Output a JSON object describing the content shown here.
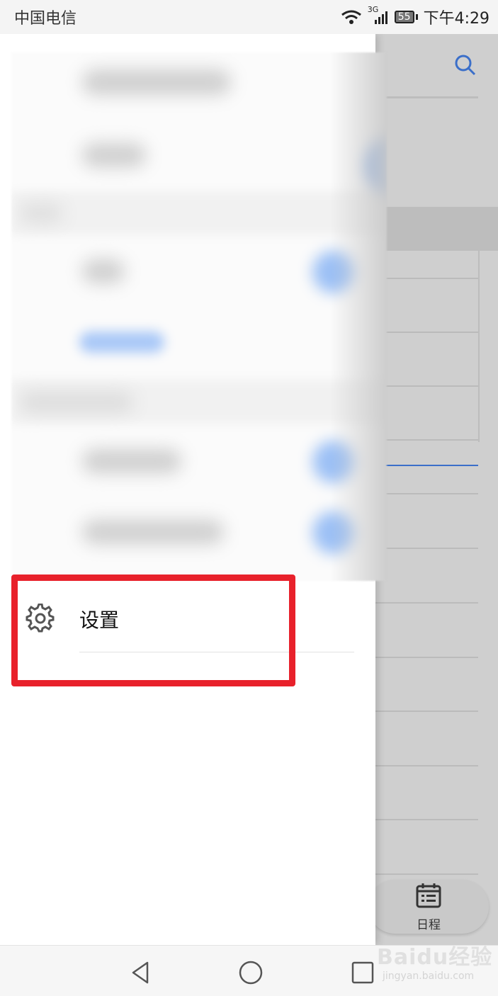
{
  "status_bar": {
    "carrier": "中国电信",
    "network": "3G",
    "battery": "55",
    "time": "下午4:29"
  },
  "drawer": {
    "settings_label": "设置"
  },
  "background_app": {
    "tab_label": "日程"
  },
  "navigation": {
    "back": "back",
    "home": "home",
    "recents": "recents"
  },
  "watermark": {
    "main": "Baidu经验",
    "sub": "jingyan.baidu.com"
  },
  "colors": {
    "highlight": "#e8212b",
    "accent_blue": "#3b6fc9"
  },
  "icons": {
    "settings": "gear-icon",
    "search": "search-icon",
    "calendar": "calendar-icon",
    "back": "triangle-back-icon",
    "home": "circle-home-icon",
    "recents": "square-recents-icon"
  }
}
